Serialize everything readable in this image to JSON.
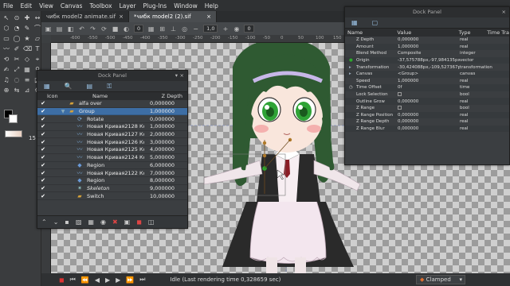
{
  "menu": [
    "File",
    "Edit",
    "View",
    "Canvas",
    "Toolbox",
    "Layer",
    "Plug-Ins",
    "Window",
    "Help"
  ],
  "tabs": [
    {
      "label": "чибк model2 animate.sif",
      "close": "×"
    },
    {
      "label": "*чибк model2 (2).sif",
      "close": "×"
    }
  ],
  "canvas_toolbar": {
    "zoom_a": "0",
    "zoom_b": "1,0",
    "frame": "0"
  },
  "ruler_ticks": [
    "-600",
    "-550",
    "-500",
    "-450",
    "-400",
    "-350",
    "-300",
    "-250",
    "-200",
    "-150",
    "-100",
    "-50",
    "0",
    "50",
    "100",
    "150",
    "200"
  ],
  "toolbox": {
    "width_value": "15"
  },
  "layers_panel": {
    "title": "Dock Panel",
    "columns": {
      "icon": "Icon",
      "name": "Name",
      "depth": "Z Depth"
    },
    "rows": [
      {
        "name": "alfa over",
        "depth": "0,000000",
        "selected": false,
        "icon": "folder-icon"
      },
      {
        "name": "Group",
        "depth": "1,000000",
        "selected": true,
        "icon": "folder-icon"
      },
      {
        "name": "Rotate",
        "depth": "0,000000",
        "selected": false,
        "icon": "rotate-icon"
      },
      {
        "name": "Новая Кривая2128 Контур",
        "depth": "1,000000",
        "selected": false,
        "icon": "outline-icon"
      },
      {
        "name": "Новая Кривая2127 Контур",
        "depth": "2,000000",
        "selected": false,
        "icon": "outline-icon"
      },
      {
        "name": "Новая Кривая2126 Контур",
        "depth": "3,000000",
        "selected": false,
        "icon": "outline-icon"
      },
      {
        "name": "Новая Кривая2125 Контур",
        "depth": "4,000000",
        "selected": false,
        "icon": "outline-icon"
      },
      {
        "name": "Новая Кривая2124 Контур",
        "depth": "5,000000",
        "selected": false,
        "icon": "outline-icon"
      },
      {
        "name": "Region",
        "depth": "6,000000",
        "selected": false,
        "icon": "region-icon"
      },
      {
        "name": "Новая Кривая2122 Контур",
        "depth": "7,000000",
        "selected": false,
        "icon": "outline-icon"
      },
      {
        "name": "Region",
        "depth": "8,000000",
        "selected": false,
        "icon": "region-icon"
      },
      {
        "name": "Skeleton",
        "depth": "9,000000",
        "selected": false,
        "icon": "skeleton-icon"
      },
      {
        "name": "Switch",
        "depth": "10,00000",
        "selected": false,
        "icon": "switch-icon"
      }
    ]
  },
  "params_panel": {
    "title": "Dock Panel",
    "columns": {
      "name": "Name",
      "value": "Value",
      "type": "Type",
      "time": "Time Tra"
    },
    "rows": [
      {
        "name": "Z Depth",
        "value": "0,000000",
        "type": "real",
        "icon": ""
      },
      {
        "name": "Amount",
        "value": "1,000000",
        "type": "real",
        "icon": ""
      },
      {
        "name": "Blend Method",
        "value": "Composite",
        "type": "integer",
        "icon": ""
      },
      {
        "name": "Origin",
        "value": "-37,575788px,-97,984135px",
        "type": "vector",
        "icon": "dot"
      },
      {
        "name": "Transformation",
        "value": "-30,424088px,-109,527367px",
        "type": "transformation",
        "icon": "expander"
      },
      {
        "name": "Canvas",
        "value": "<Group>",
        "type": "canvas",
        "icon": "expander"
      },
      {
        "name": "Speed",
        "value": "1,000000",
        "type": "real",
        "icon": ""
      },
      {
        "name": "Time Offset",
        "value": "0f",
        "type": "time",
        "icon": "clock"
      },
      {
        "name": "Lock Selection",
        "value": "",
        "type": "bool",
        "icon": "",
        "checkbox": true
      },
      {
        "name": "Outline Grow",
        "value": "0,000000",
        "type": "real",
        "icon": ""
      },
      {
        "name": "Z Range",
        "value": "",
        "type": "bool",
        "icon": "",
        "checkbox": true
      },
      {
        "name": "Z Range Position",
        "value": "0,000000",
        "type": "real",
        "icon": ""
      },
      {
        "name": "Z Range Depth",
        "value": "0,000000",
        "type": "real",
        "icon": ""
      },
      {
        "name": "Z Range Blur",
        "value": "0,000000",
        "type": "real",
        "icon": ""
      }
    ]
  },
  "statusbar": {
    "status": "Idle (Last rendering time 0,328659 sec)",
    "interpolation": "Clamped"
  },
  "colors": {
    "accent_selected": "#3d6ea5",
    "hair": "#2f5a32",
    "eyes": "#2fa336",
    "dress_dark": "#2a2a2a",
    "apron": "#f3e6ee"
  }
}
